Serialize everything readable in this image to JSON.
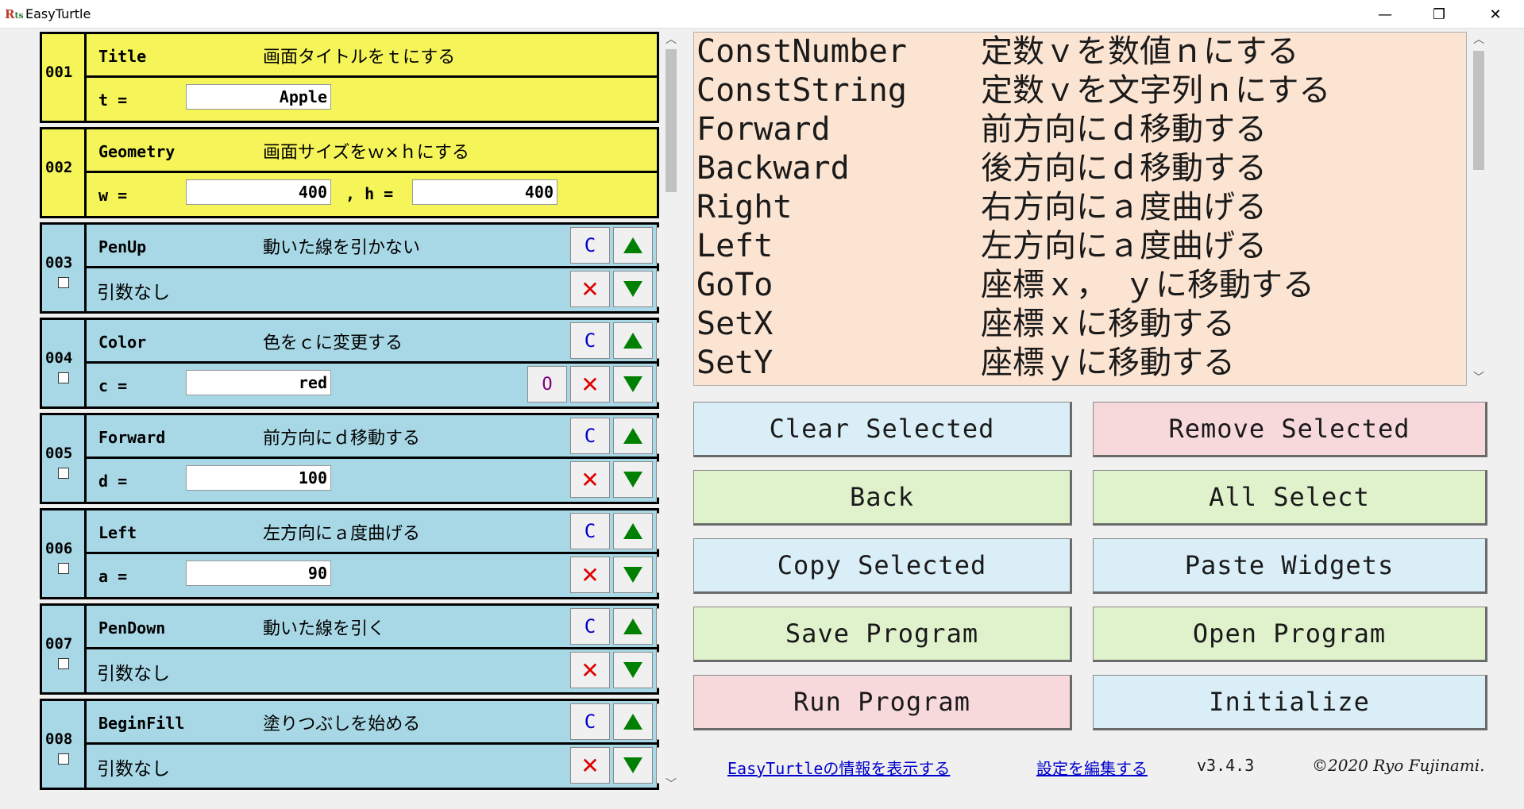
{
  "window": {
    "title": "EasyTurtle",
    "icon_text": "R",
    "icon_sub": "ts"
  },
  "controls": {
    "minimize": "—",
    "restore": "❐",
    "close": "✕"
  },
  "widgets": [
    {
      "num": "001",
      "name": "Title",
      "desc": "画面タイトルをｔにする",
      "label1": "t =",
      "value1": "Apple"
    },
    {
      "num": "002",
      "name": "Geometry",
      "desc": "画面サイズをｗ×ｈにする",
      "label1": "w =",
      "value1": "400",
      "sep": ", h =",
      "value2": "400"
    },
    {
      "num": "003",
      "name": "PenUp",
      "desc": "動いた線を引かない",
      "noarg": "引数なし"
    },
    {
      "num": "004",
      "name": "Color",
      "desc": "色をｃに変更する",
      "label1": "c =",
      "value1": "red"
    },
    {
      "num": "005",
      "name": "Forward",
      "desc": "前方向にｄ移動する",
      "label1": "d =",
      "value1": "100"
    },
    {
      "num": "006",
      "name": "Left",
      "desc": "左方向にａ度曲げる",
      "label1": "a =",
      "value1": "90"
    },
    {
      "num": "007",
      "name": "PenDown",
      "desc": "動いた線を引く",
      "noarg": "引数なし"
    },
    {
      "num": "008",
      "name": "BeginFill",
      "desc": "塗りつぶしを始める",
      "noarg": "引数なし"
    }
  ],
  "widget_buttons": {
    "copy": "C",
    "delete": "✕",
    "option": "O"
  },
  "reference": [
    {
      "name": "ConstNumber",
      "desc": "定数ｖを数値ｎにする"
    },
    {
      "name": "ConstString",
      "desc": "定数ｖを文字列ｎにする"
    },
    {
      "name": "Forward",
      "desc": "前方向にｄ移動する"
    },
    {
      "name": "Backward",
      "desc": "後方向にｄ移動する"
    },
    {
      "name": "Right",
      "desc": "右方向にａ度曲げる"
    },
    {
      "name": "Left",
      "desc": "左方向にａ度曲げる"
    },
    {
      "name": "GoTo",
      "desc": "座標ｘ，　ｙに移動する"
    },
    {
      "name": "SetX",
      "desc": "座標ｘに移動する"
    },
    {
      "name": "SetY",
      "desc": "座標ｙに移動する"
    }
  ],
  "actions": {
    "clear_selected": "Clear Selected",
    "remove_selected": "Remove Selected",
    "back": "Back",
    "all_select": "All Select",
    "copy_selected": "Copy Selected",
    "paste_widgets": "Paste Widgets",
    "save_program": "Save Program",
    "open_program": "Open Program",
    "run_program": "Run Program",
    "initialize": "Initialize"
  },
  "footer": {
    "info_link": "EasyTurtleの情報を表示する",
    "settings_link": "設定を編集する",
    "version": "v3.4.3",
    "copyright": "©2020 Ryo Fujinami."
  },
  "colors": {
    "widget_yellow": "#f5f55a",
    "widget_blue": "#a8d8e6",
    "reference_bg": "#fce4d2",
    "btn_blue": "#d9eef7",
    "btn_pink": "#f7d9dc",
    "btn_green": "#dff2cc"
  }
}
